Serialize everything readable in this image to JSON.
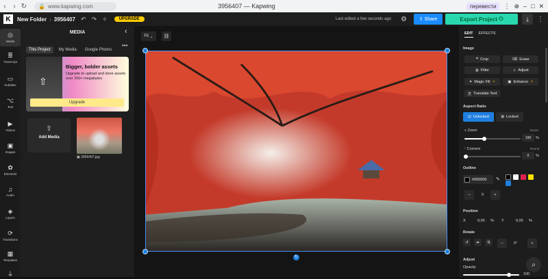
{
  "browser": {
    "url": "www.kapwing.com",
    "window_title": "3956407 — Kapwing",
    "translate_label": "перевести"
  },
  "appbar": {
    "folder": "New Folder",
    "project": "3956407",
    "upgrade_label": "UPGRADE",
    "last_edited": "Last edited a few seconds ago",
    "share_label": "Share",
    "export_label": "Export Project"
  },
  "left_rail": {
    "items": [
      {
        "label": "Media",
        "icon": "media-icon"
      },
      {
        "label": "Transcript",
        "icon": "transcript-icon"
      },
      {
        "label": "Subtitles",
        "icon": "subtitles-icon"
      },
      {
        "label": "Text",
        "icon": "text-icon"
      },
      {
        "label": "Videos",
        "icon": "videos-icon"
      },
      {
        "label": "Images",
        "icon": "images-icon"
      },
      {
        "label": "Elements",
        "icon": "elements-icon"
      },
      {
        "label": "Audio",
        "icon": "audio-icon"
      },
      {
        "label": "Layers",
        "icon": "layers-icon"
      },
      {
        "label": "Transitions",
        "icon": "transitions-icon"
      },
      {
        "label": "Templates",
        "icon": "templates-icon"
      }
    ]
  },
  "media_panel": {
    "title": "MEDIA",
    "tabs": [
      "This Project",
      "My Media",
      "Google Photos"
    ],
    "promo_heading": "Bigger, bolder assets",
    "promo_text": "Upgrade to upload and store assets over 250+ megabytes",
    "promo_button": "Upgrade",
    "add_media_label": "Add Media",
    "file_name": "3956407.jpg"
  },
  "canvas": {
    "fit_label": "Fit"
  },
  "right_panel": {
    "tabs": [
      "EDIT",
      "EFFECTS"
    ],
    "image_section": "Image",
    "image_buttons": [
      "Crop",
      "Erase",
      "Filter",
      "Adjust",
      "Magic Fill",
      "Enhance",
      "Translate Text"
    ],
    "aspect_section": "Aspect Ratio",
    "aspect_buttons": [
      "Unlocked",
      "Locked"
    ],
    "zoom_label": "Zoom",
    "zoom_reset": "Reset",
    "zoom_value": "100",
    "zoom_unit": "%",
    "zoom_level": 0.35,
    "corners_label": "Corners",
    "corners_round": "Round",
    "corners_value": "0",
    "corners_unit": "%",
    "outline_section": "Outline",
    "outline_color": "#000000",
    "outline_width": "0",
    "swatches": [
      "#000000",
      "#ffffff",
      "#e0234e",
      "#ffe000",
      "#1f7fe0"
    ],
    "position_section": "Position",
    "x_label": "X",
    "x_value": "0,00",
    "y_label": "Y",
    "y_value": "0,00",
    "pos_unit": "%",
    "rotate_section": "Rotate",
    "rotate_value": "0°",
    "adjust_section": "Adjust",
    "opacity_label": "Opacity",
    "opacity_value": "100"
  }
}
